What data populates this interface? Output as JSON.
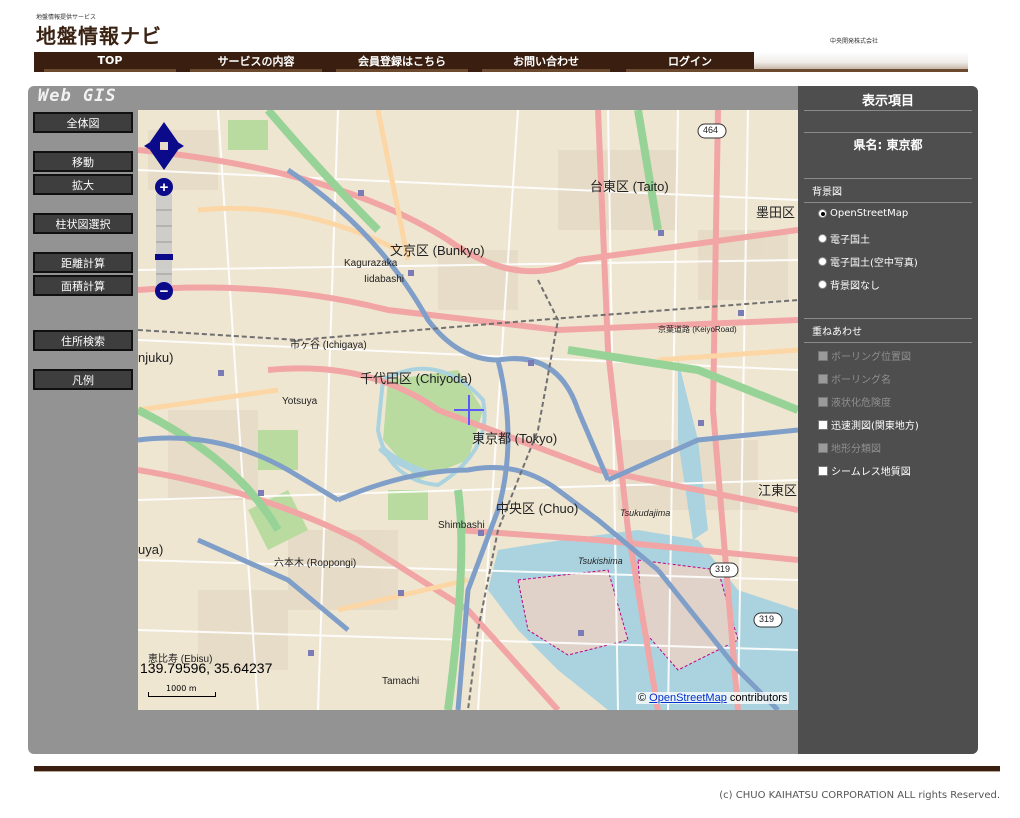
{
  "header": {
    "subtitle": "地盤情報提供サービス",
    "logo": "地盤情報ナビ",
    "company_small": "中央開発株式会社"
  },
  "nav": [
    {
      "label": "TOP"
    },
    {
      "label": "サービスの内容"
    },
    {
      "label": "会員登録はこちら"
    },
    {
      "label": "お問い合わせ"
    },
    {
      "label": "ログイン"
    }
  ],
  "gis": {
    "title": "Web GIS",
    "tools": [
      {
        "label": "全体図"
      },
      {
        "label": "移動"
      },
      {
        "label": "拡大"
      },
      {
        "label": "柱状図選択"
      },
      {
        "label": "距離計算"
      },
      {
        "label": "面積計算"
      },
      {
        "label": "住所検索"
      },
      {
        "label": "凡例"
      }
    ]
  },
  "map": {
    "coordinates": "139.79596, 35.64237",
    "scale_label": "1000 m",
    "attribution_prefix": "©",
    "attribution_link": "OpenStreetMap",
    "attribution_suffix": "contributors",
    "labels": {
      "taito": "台東区 (Taito)",
      "bunkyo": "文京区 (Bunkyo)",
      "chiyoda": "千代田区 (Chiyoda)",
      "tokyo": "東京都 (Tokyo)",
      "chuo": "中央区 (Chuo)",
      "kagurazaka": "Kagurazaka",
      "iidabashi": "Iidabashi",
      "ichigaya": "市ヶ谷 (Ichigaya)",
      "yotsuya": "Yotsuya",
      "roppongi": "六本木 (Roppongi)",
      "shimbashi": "Shimbashi",
      "tsukishima": "Tsukishima",
      "tsukudajima": "Tsukudajima",
      "tamachi": "Tamachi",
      "ebisu": "恵比寿 (Ebisu)",
      "shinjuku": "njuku)",
      "sumida": "墨田区",
      "koto": "江東区",
      "shibuya": "uya)",
      "route_464": "464",
      "route_319a": "319",
      "route_319b": "319",
      "keiyo": "京葉道路 (KeiyoRoad)"
    },
    "zoom_plus": "+",
    "zoom_minus": "−"
  },
  "panel": {
    "title": "表示項目",
    "prefecture_label": "県名: 東京都",
    "background_section": "背景図",
    "background_options": [
      {
        "label": "OpenStreetMap",
        "selected": true
      },
      {
        "label": "電子国土",
        "selected": false
      },
      {
        "label": "電子国土(空中写真)",
        "selected": false
      },
      {
        "label": "背景図なし",
        "selected": false
      }
    ],
    "overlay_section": "重ねあわせ",
    "overlay_options": [
      {
        "label": "ボーリング位置図",
        "enabled": false
      },
      {
        "label": "ボーリング名",
        "enabled": false
      },
      {
        "label": "液状化危険度",
        "enabled": false
      },
      {
        "label": "迅速測図(関東地方)",
        "enabled": true
      },
      {
        "label": "地形分類図",
        "enabled": false
      },
      {
        "label": "シームレス地質図",
        "enabled": true
      }
    ]
  },
  "footer": {
    "copyright": "(c) CHUO KAIHATSU CORPORATION ALL rights Reserved."
  },
  "colors": {
    "brand_brown": "#3a1f10",
    "panel_gray": "#939393",
    "panel_dark": "#4e4e4e"
  }
}
